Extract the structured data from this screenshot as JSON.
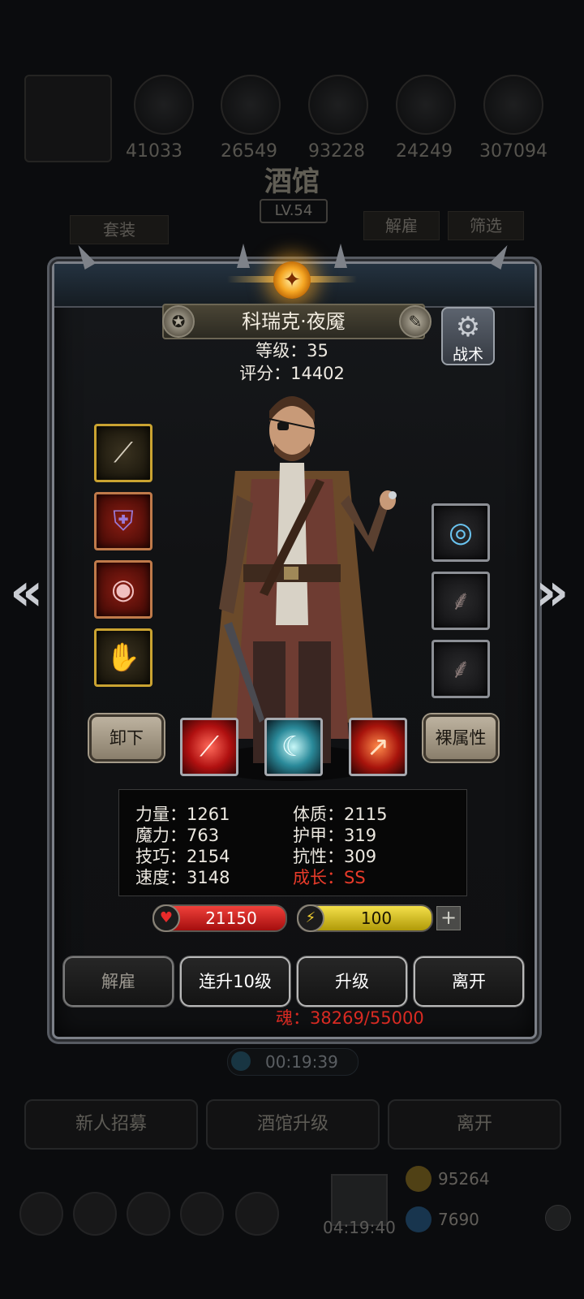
{
  "background": {
    "resource_values": [
      "41033",
      "26549",
      "93228",
      "24249",
      "307094"
    ],
    "title": "酒馆",
    "level": "LV.54",
    "tab_set": "套装",
    "tab_dismiss": "解雇",
    "tab_filter": "筛选",
    "timer": "00:19:39",
    "buttons": [
      "新人招募",
      "酒馆升级",
      "离开"
    ],
    "bottom_timer": "04:19:40",
    "gold": "95264",
    "gems": "7690"
  },
  "hero": {
    "name": "科瑞克·夜魇",
    "level_line": "等级：35",
    "score_line": "评分：14402",
    "tactic_label": "战术"
  },
  "equipment": {
    "left": [
      "spear-icon",
      "chest-armor-icon",
      "ring-icon",
      "gauntlet-icon"
    ],
    "right": [
      "orb-icon",
      "feather-icon",
      "feather-icon"
    ]
  },
  "controls": {
    "unequip_label": "卸下",
    "base_attr_label": "裸属性"
  },
  "skills": [
    "slash-skill-icon",
    "wind-blade-skill-icon",
    "fire-spear-skill-icon"
  ],
  "stats": {
    "strength": "力量：1261",
    "magic": "魔力：763",
    "skill": "技巧：2154",
    "speed": "速度：3148",
    "constitution": "体质：2115",
    "armor": "护甲：319",
    "resistance": "抗性：309",
    "growth": "成长：SS"
  },
  "bars": {
    "hp": "21150",
    "energy": "100"
  },
  "actions": {
    "dismiss": "解雇",
    "upgrade10": "连升10级",
    "upgrade": "升级",
    "leave": "离开"
  },
  "soul": "魂：38269/55000",
  "colors": {
    "gold_border": "#caa331",
    "growth_red": "#e83b2a",
    "hp_red": "#d82020",
    "energy_yellow": "#f4e04a"
  }
}
